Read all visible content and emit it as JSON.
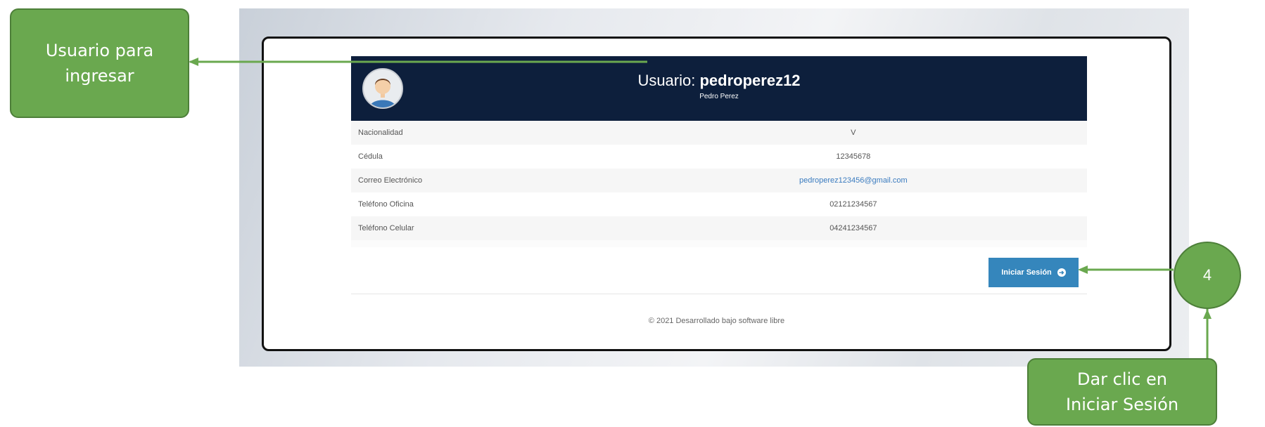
{
  "header": {
    "title_prefix": "Usuario:",
    "username": "pedroperez12",
    "full_name": "Pedro Perez"
  },
  "details": [
    {
      "label": "Nacionalidad",
      "value": "V"
    },
    {
      "label": "Cédula",
      "value": "12345678"
    },
    {
      "label": "Correo Electrónico",
      "value": "pedroperez123456@gmail.com"
    },
    {
      "label": "Teléfono Oficina",
      "value": "02121234567"
    },
    {
      "label": "Teléfono Celular",
      "value": "04241234567"
    }
  ],
  "login_button": {
    "label": "Iniciar Sesión",
    "icon": "arrow-right-circle-icon"
  },
  "footer": {
    "text": "© 2021 Desarrollado bajo software libre"
  },
  "annotations": {
    "user_callout": {
      "line1": "Usuario para",
      "line2": "ingresar"
    },
    "step_number": "4",
    "click_callout": {
      "line1": "Dar clic en",
      "line2": "Iniciar Sesión"
    }
  },
  "colors": {
    "header_bg": "#0d1f3c",
    "button_bg": "#3586bc",
    "callout_green": "#6aa84f",
    "link": "#3a7bbf"
  }
}
